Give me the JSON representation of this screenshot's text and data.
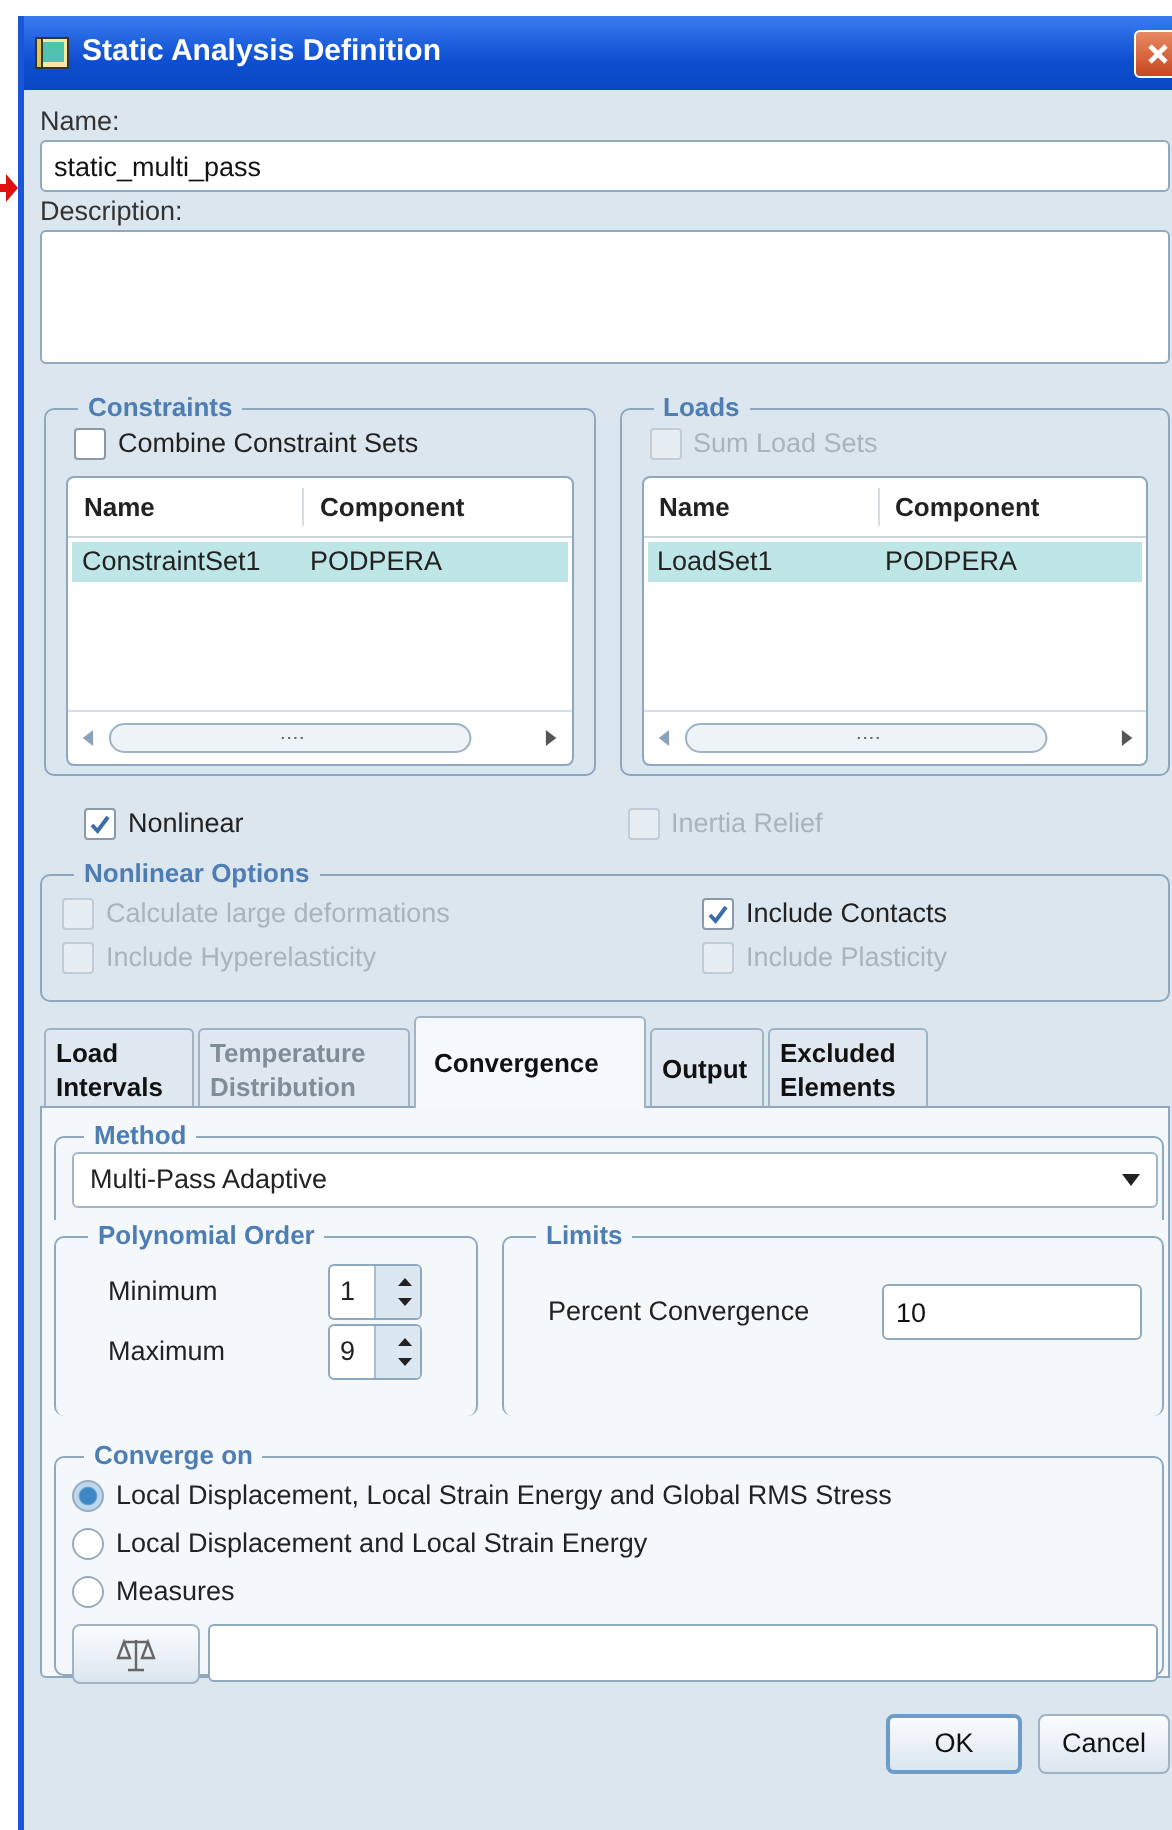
{
  "window": {
    "title": "Static Analysis Definition"
  },
  "name": {
    "label": "Name:",
    "value": "static_multi_pass"
  },
  "description": {
    "label": "Description:"
  },
  "sets": [
    {
      "title": "Constraints",
      "checkbox": {
        "label": "Combine Constraint Sets",
        "checked": false,
        "disabled": false
      },
      "columns": [
        "Name",
        "Component"
      ],
      "rows": [
        {
          "cells": [
            "ConstraintSet1",
            "PODPERA"
          ],
          "selected": true
        }
      ]
    },
    {
      "title": "Loads",
      "checkbox": {
        "label": "Sum Load Sets",
        "checked": false,
        "disabled": true
      },
      "columns": [
        "Name",
        "Component"
      ],
      "rows": [
        {
          "cells": [
            "LoadSet1",
            "PODPERA"
          ],
          "selected": true
        }
      ]
    }
  ],
  "options": [
    {
      "label": "Nonlinear",
      "checked": true,
      "disabled": false
    },
    {
      "label": "Inertia Relief",
      "checked": false,
      "disabled": true
    }
  ],
  "nonlinear_options": {
    "title": "Nonlinear Options",
    "items": [
      {
        "label": "Calculate large deformations",
        "checked": false,
        "disabled": true
      },
      {
        "label": "Include Contacts",
        "checked": true,
        "disabled": false
      },
      {
        "label": "Include Hyperelasticity",
        "checked": false,
        "disabled": true
      },
      {
        "label": "Include Plasticity",
        "checked": false,
        "disabled": true
      }
    ]
  },
  "tabs": [
    {
      "label": "Load Intervals",
      "selected": false,
      "disabled": false
    },
    {
      "label": "Temperature Distribution",
      "selected": false,
      "disabled": true
    },
    {
      "label": "Convergence",
      "selected": true,
      "disabled": false
    },
    {
      "label": "Output",
      "selected": false,
      "disabled": false
    },
    {
      "label": "Excluded Elements",
      "selected": false,
      "disabled": false
    }
  ],
  "method": {
    "title": "Method",
    "value": "Multi-Pass Adaptive"
  },
  "polynomial_order": {
    "title": "Polynomial Order",
    "fields": [
      {
        "label": "Minimum",
        "value": "1"
      },
      {
        "label": "Maximum",
        "value": "9"
      }
    ]
  },
  "limits": {
    "title": "Limits",
    "fields": [
      {
        "label": "Percent Convergence",
        "value": "10"
      }
    ]
  },
  "converge_on": {
    "title": "Converge on",
    "options": [
      {
        "label": "Local Displacement, Local Strain Energy and Global RMS Stress",
        "selected": true
      },
      {
        "label": "Local Displacement and Local Strain Energy",
        "selected": false
      },
      {
        "label": "Measures",
        "selected": false
      }
    ]
  },
  "buttons": [
    {
      "label": "OK",
      "default": true
    },
    {
      "label": "Cancel",
      "default": false
    }
  ]
}
